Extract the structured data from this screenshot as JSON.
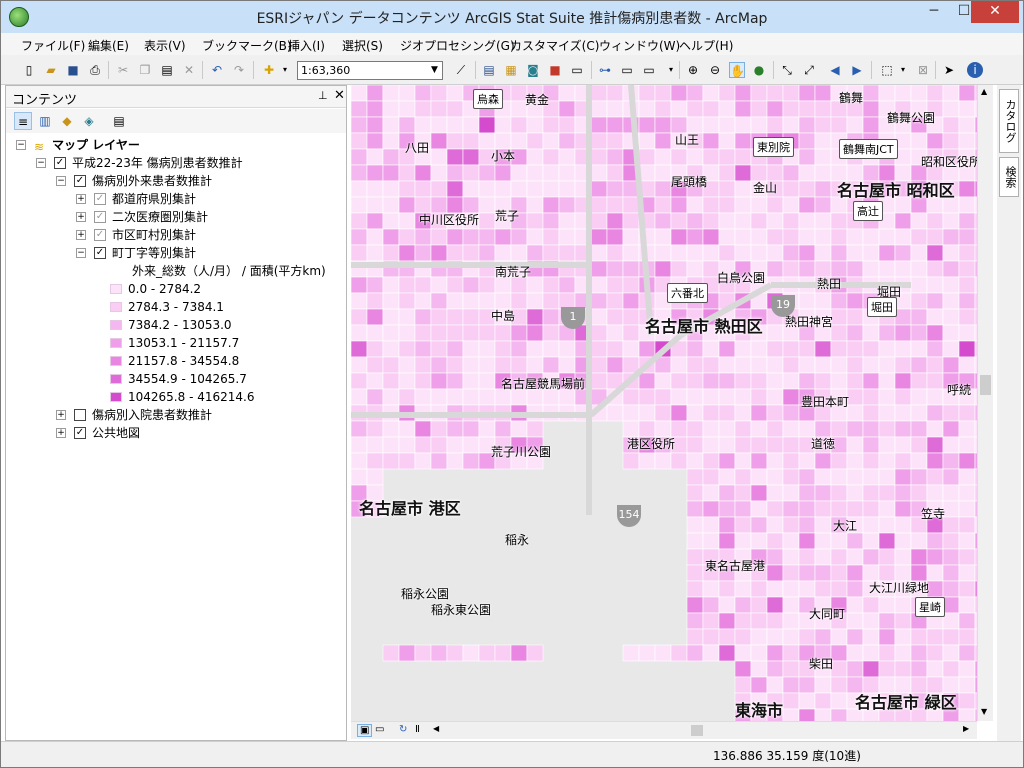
{
  "window": {
    "title": "ESRIジャパン データコンテンツ ArcGIS Stat Suite 推計傷病別患者数 - ArcMap",
    "min": "─",
    "max": "☐",
    "close": "✕"
  },
  "menu": [
    "ファイル(F)",
    "編集(E)",
    "表示(V)",
    "ブックマーク(B)",
    "挿入(I)",
    "選択(S)",
    "ジオプロセシング(G)",
    "カスタマイズ(C)",
    "ウィンドウ(W)",
    "ヘルプ(H)"
  ],
  "toolbar": {
    "scale": "1:63,360"
  },
  "toc": {
    "title": "コンテンツ",
    "pin": "ᵖ",
    "close": "✕",
    "root": "マップ レイヤー",
    "group": "平成22-23年 傷病別患者数推計",
    "subgroup": "傷病別外来患者数推計",
    "layers": [
      "都道府県別集計",
      "二次医療圏別集計",
      "市区町村別集計",
      "町丁字等別集計"
    ],
    "legend_field": "外来_総数（人/月） / 面積(平方km)",
    "legend": [
      {
        "label": "0.0 - 2784.2",
        "color": "#fde3f9"
      },
      {
        "label": "2784.3 - 7384.1",
        "color": "#f9cdf4"
      },
      {
        "label": "7384.2 - 13053.0",
        "color": "#f4b7ef"
      },
      {
        "label": "13053.1 - 21157.7",
        "color": "#ef9fe9"
      },
      {
        "label": "21157.8 - 34554.8",
        "color": "#e886e2"
      },
      {
        "label": "34554.9 - 104265.7",
        "color": "#df6bd8"
      },
      {
        "label": "104265.8 - 416214.6",
        "color": "#d44ccd"
      }
    ],
    "inpatient": "傷病別入院患者数推計",
    "basemap": "公共地図"
  },
  "map": {
    "wards": [
      "名古屋市 昭和区",
      "名古屋市 熱田区",
      "名古屋市 港区",
      "東海市",
      "名古屋市 緑区"
    ],
    "labels": [
      "黄金",
      "鶴舞",
      "鶴舞公園",
      "八田",
      "小本",
      "山王",
      "尾頭橋",
      "金山",
      "昭和区役所",
      "中川区役所",
      "荒子",
      "白鳥公園",
      "熱田",
      "南荒子",
      "中島",
      "熱田神宮",
      "堀田",
      "名古屋競馬場前",
      "呼続",
      "豊田本町",
      "港区役所",
      "道徳",
      "荒子川公園",
      "笠寺",
      "稲永",
      "大江",
      "東名古屋港",
      "大江川緑地",
      "稲永公園",
      "稲永東公園",
      "大同町",
      "柴田"
    ],
    "stations": [
      "烏森",
      "東別院",
      "鶴舞南JCT",
      "高辻",
      "六番北",
      "堀田",
      "星崎"
    ],
    "routes": [
      "1",
      "19",
      "154"
    ]
  },
  "dock": {
    "catalog": "カタログ",
    "search": "検索"
  },
  "status": {
    "coords": "136.886  35.159 度(10進)"
  }
}
